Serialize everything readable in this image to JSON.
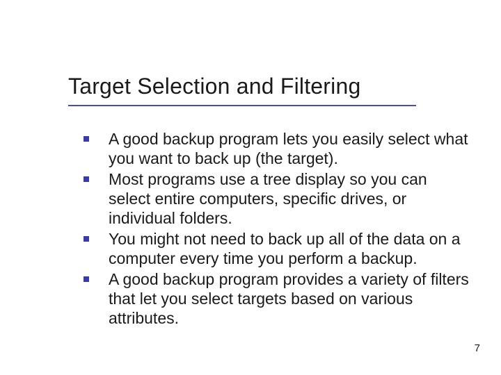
{
  "slide": {
    "title": "Target Selection and Filtering",
    "bullets": [
      {
        "text": "A good backup program lets you easily select what you want to back up (the target)."
      },
      {
        "text": "Most programs use a tree display so you can select entire computers, specific drives, or individual folders."
      },
      {
        "text": "You might not need to back up all of the data on a computer every time you perform a backup."
      },
      {
        "text": "A good backup program provides a variety of filters that let you select targets based on various attributes."
      }
    ],
    "page_number": "7"
  }
}
